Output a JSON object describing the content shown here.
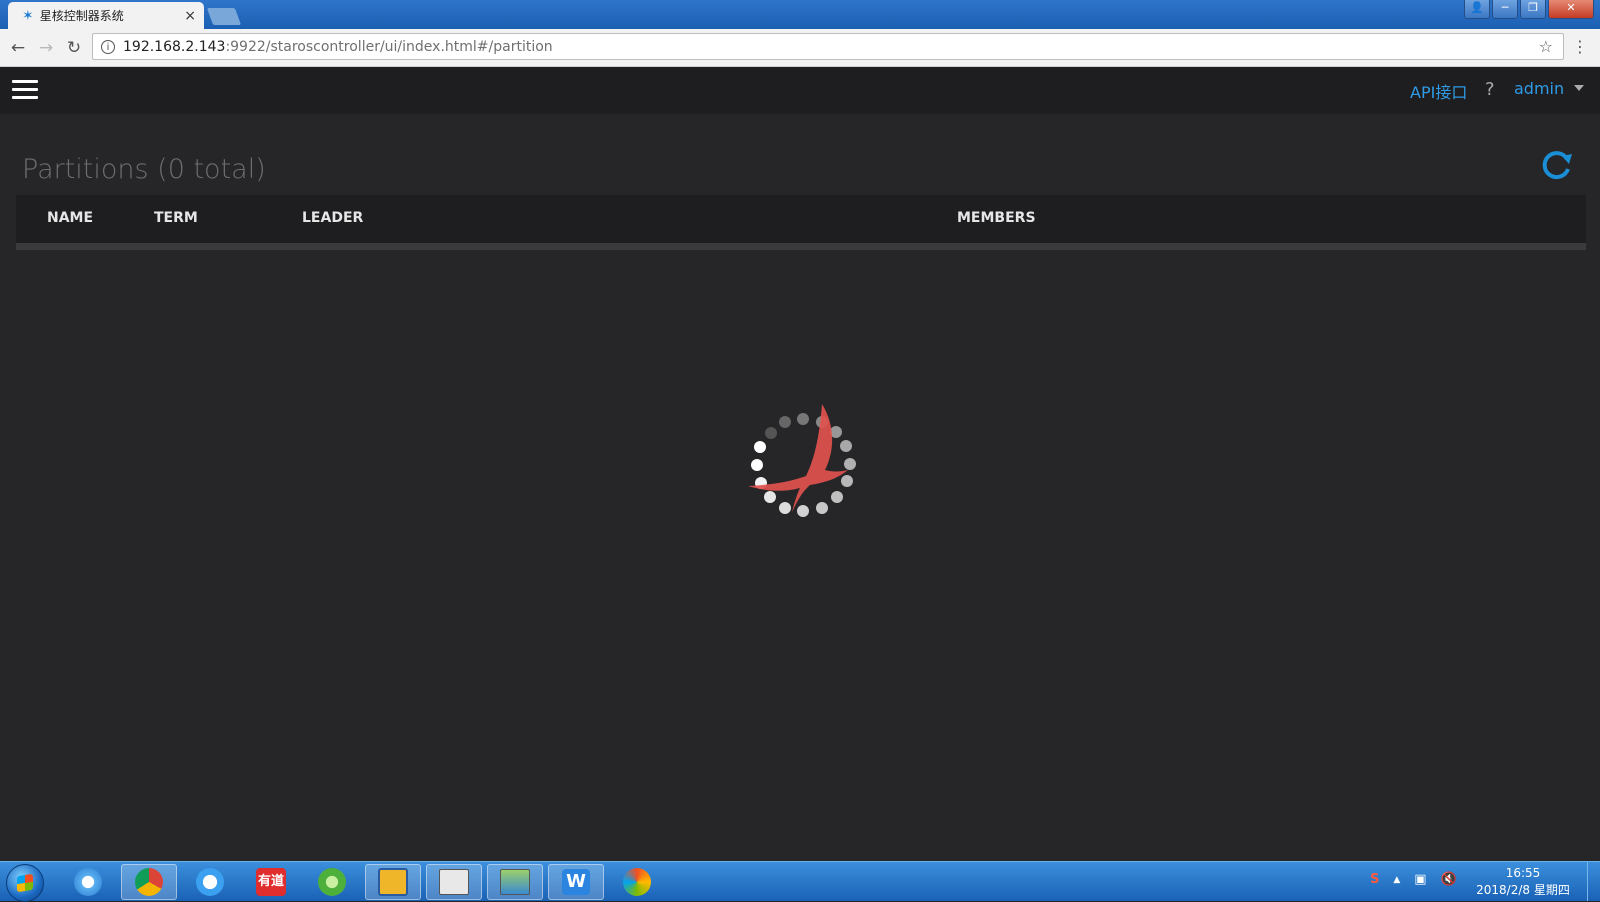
{
  "browser": {
    "tab_title": "星核控制器系统",
    "tab_close": "×",
    "url_host": "192.168.2.143",
    "url_path": ":9922/staroscontroller/ui/index.html#/partition",
    "back_icon": "←",
    "forward_icon": "→",
    "reload_icon": "↻",
    "info_icon": "i",
    "star_icon": "☆",
    "menu_icon": "⋮"
  },
  "window_controls": {
    "user": "👤",
    "minimize": "─",
    "maximize": "❐",
    "close": "✕"
  },
  "navbar": {
    "api_link": "API接口",
    "help": "?",
    "user": "admin"
  },
  "page": {
    "title": "Partitions (0 total)"
  },
  "table": {
    "columns": [
      "NAME",
      "TERM",
      "LEADER",
      "MEMBERS"
    ]
  },
  "taskbar": {
    "apps": [
      "ie-icon",
      "chrome-icon",
      "edge-icon",
      "youdao-icon",
      "refresh-app-icon",
      "folder-app-icon",
      "terminal-app-icon",
      "photo-app-icon",
      "wps-icon",
      "paint-icon"
    ],
    "youdao_label": "有道",
    "wps_label": "W",
    "tray_sogou": "S",
    "tray_up": "▲",
    "tray_network": "▣",
    "tray_volume": "🔇",
    "time": "16:55",
    "date": "2018/2/8 星期四"
  },
  "colors": {
    "accent": "#2f9be6",
    "background": "#262528",
    "navbar": "#1e1d1f"
  }
}
